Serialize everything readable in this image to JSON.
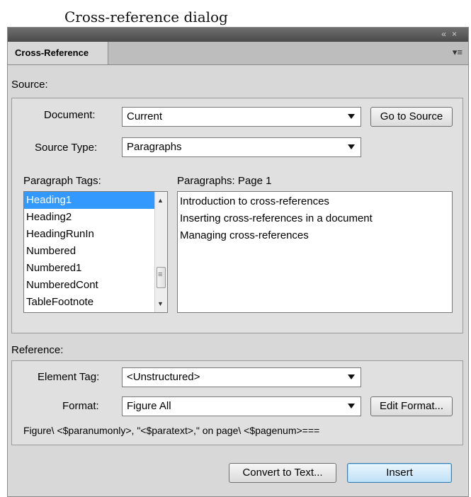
{
  "caption": "Cross-reference dialog",
  "tab": {
    "label": "Cross-Reference"
  },
  "window_controls": {
    "collapse": "«",
    "close": "×",
    "menu": "▾≡"
  },
  "source": {
    "heading": "Source:",
    "document_label": "Document:",
    "document_value": "Current",
    "go_to_source": "Go to Source",
    "source_type_label": "Source Type:",
    "source_type_value": "Paragraphs",
    "tags_label": "Paragraph Tags:",
    "tags": [
      "Heading1",
      "Heading2",
      "HeadingRunIn",
      "Numbered",
      "Numbered1",
      "NumberedCont",
      "TableFootnote"
    ],
    "selected_tag": "Heading1",
    "paragraphs_label": "Paragraphs: Page  1",
    "paragraphs": [
      "Introduction to cross-references",
      "Inserting cross-references in a document",
      "Managing cross-references"
    ]
  },
  "reference": {
    "heading": "Reference:",
    "element_tag_label": "Element Tag:",
    "element_tag_value": "<Unstructured>",
    "format_label": "Format:",
    "format_value": "Figure All",
    "edit_format": "Edit Format...",
    "formula": "Figure\\ <$paranumonly>, \"<$paratext>,\" on page\\ <$pagenum>==="
  },
  "actions": {
    "convert": "Convert to Text...",
    "insert": "Insert"
  }
}
